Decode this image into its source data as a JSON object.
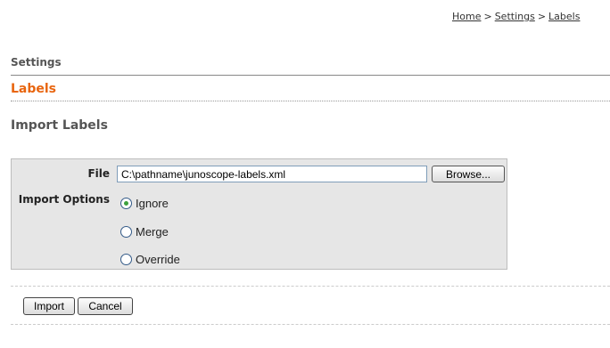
{
  "breadcrumb": {
    "items": [
      "Home",
      "Settings",
      "Labels"
    ],
    "separator": ">"
  },
  "section": {
    "label": "Settings"
  },
  "page": {
    "title": "Labels",
    "subtitle": "Import Labels"
  },
  "form": {
    "file_label": "File",
    "file_value": "C:\\pathname\\junoscope-labels.xml",
    "browse_label": "Browse...",
    "options_label": "Import Options",
    "options": [
      {
        "label": "Ignore",
        "checked": true
      },
      {
        "label": "Merge",
        "checked": false
      },
      {
        "label": "Override",
        "checked": false
      }
    ]
  },
  "actions": {
    "import_label": "Import",
    "cancel_label": "Cancel"
  },
  "colors": {
    "accent": "#e8650f",
    "radio_selected": "#3ca13c"
  }
}
